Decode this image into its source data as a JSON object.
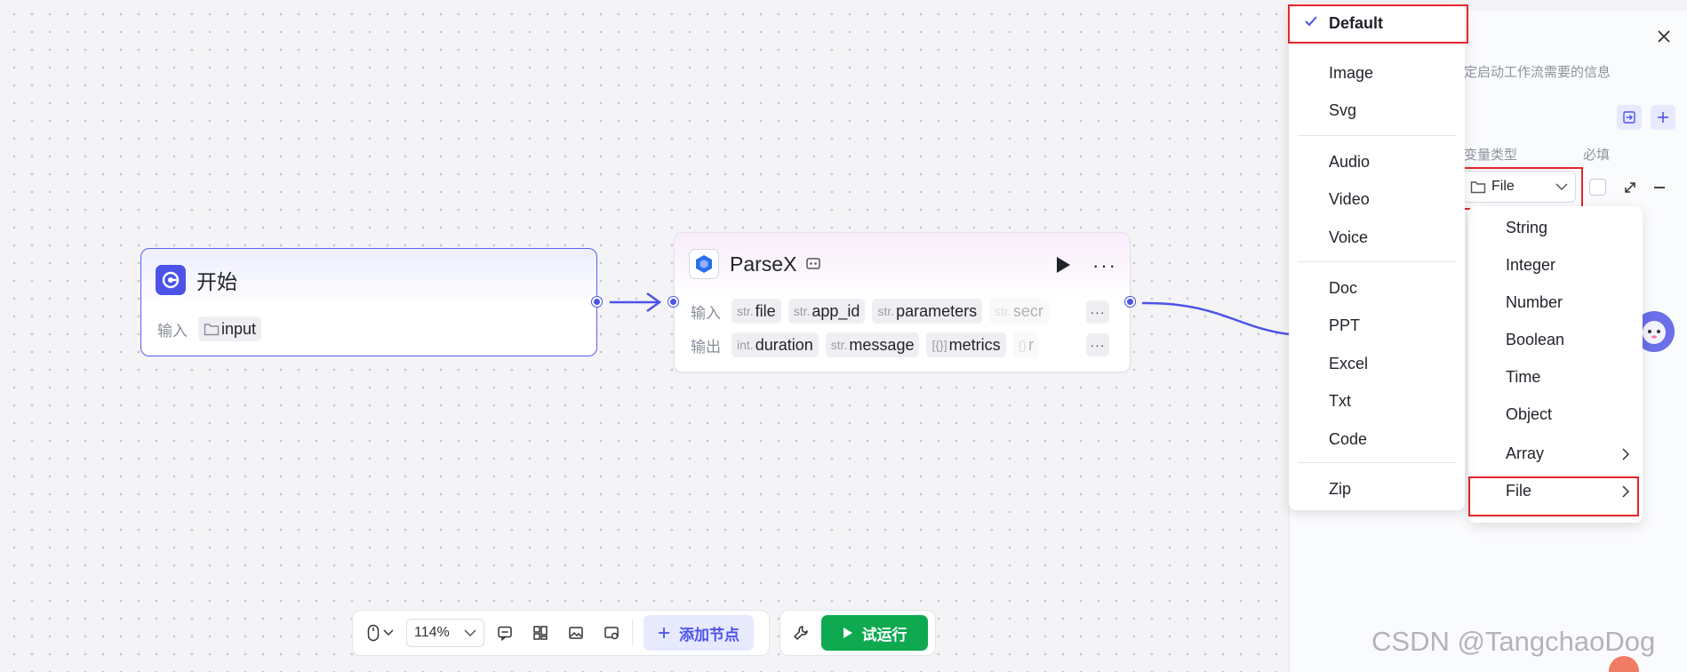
{
  "start_node": {
    "title": "开始",
    "input_label": "输入",
    "input_tag": "input"
  },
  "parsex_node": {
    "title": "ParseX",
    "input_label": "输入",
    "output_label": "输出",
    "inputs": [
      {
        "type": "str.",
        "name": "file"
      },
      {
        "type": "str.",
        "name": "app_id"
      },
      {
        "type": "str.",
        "name": "parameters"
      },
      {
        "type": "str.",
        "name": "secr"
      }
    ],
    "outputs": [
      {
        "type": "int.",
        "name": "duration"
      },
      {
        "type": "str.",
        "name": "message"
      },
      {
        "type": "[{}]",
        "name": "metrics"
      },
      {
        "type": "{}",
        "name": "r"
      }
    ],
    "more_label": "···"
  },
  "toolbar": {
    "zoom": "114%",
    "add_node": "添加节点",
    "run": "试运行"
  },
  "panel": {
    "desc_fragment": "定启动工作流需要的信息",
    "col_type": "变量类型",
    "col_required": "必填",
    "selected_type": "File"
  },
  "file_subtypes": {
    "selected": "Default",
    "groups": [
      [
        "Image",
        "Svg"
      ],
      [
        "Audio",
        "Video",
        "Voice"
      ],
      [
        "Doc",
        "PPT",
        "Excel",
        "Txt",
        "Code"
      ],
      [
        "Zip"
      ]
    ]
  },
  "type_menu": [
    "String",
    "Integer",
    "Number",
    "Boolean",
    "Time",
    "Object",
    "Array",
    "File"
  ],
  "watermark": "CSDN @TangchaoDog",
  "colors": {
    "accent": "#4d53e8",
    "run": "#0fa950",
    "highlight": "#e5252a"
  }
}
